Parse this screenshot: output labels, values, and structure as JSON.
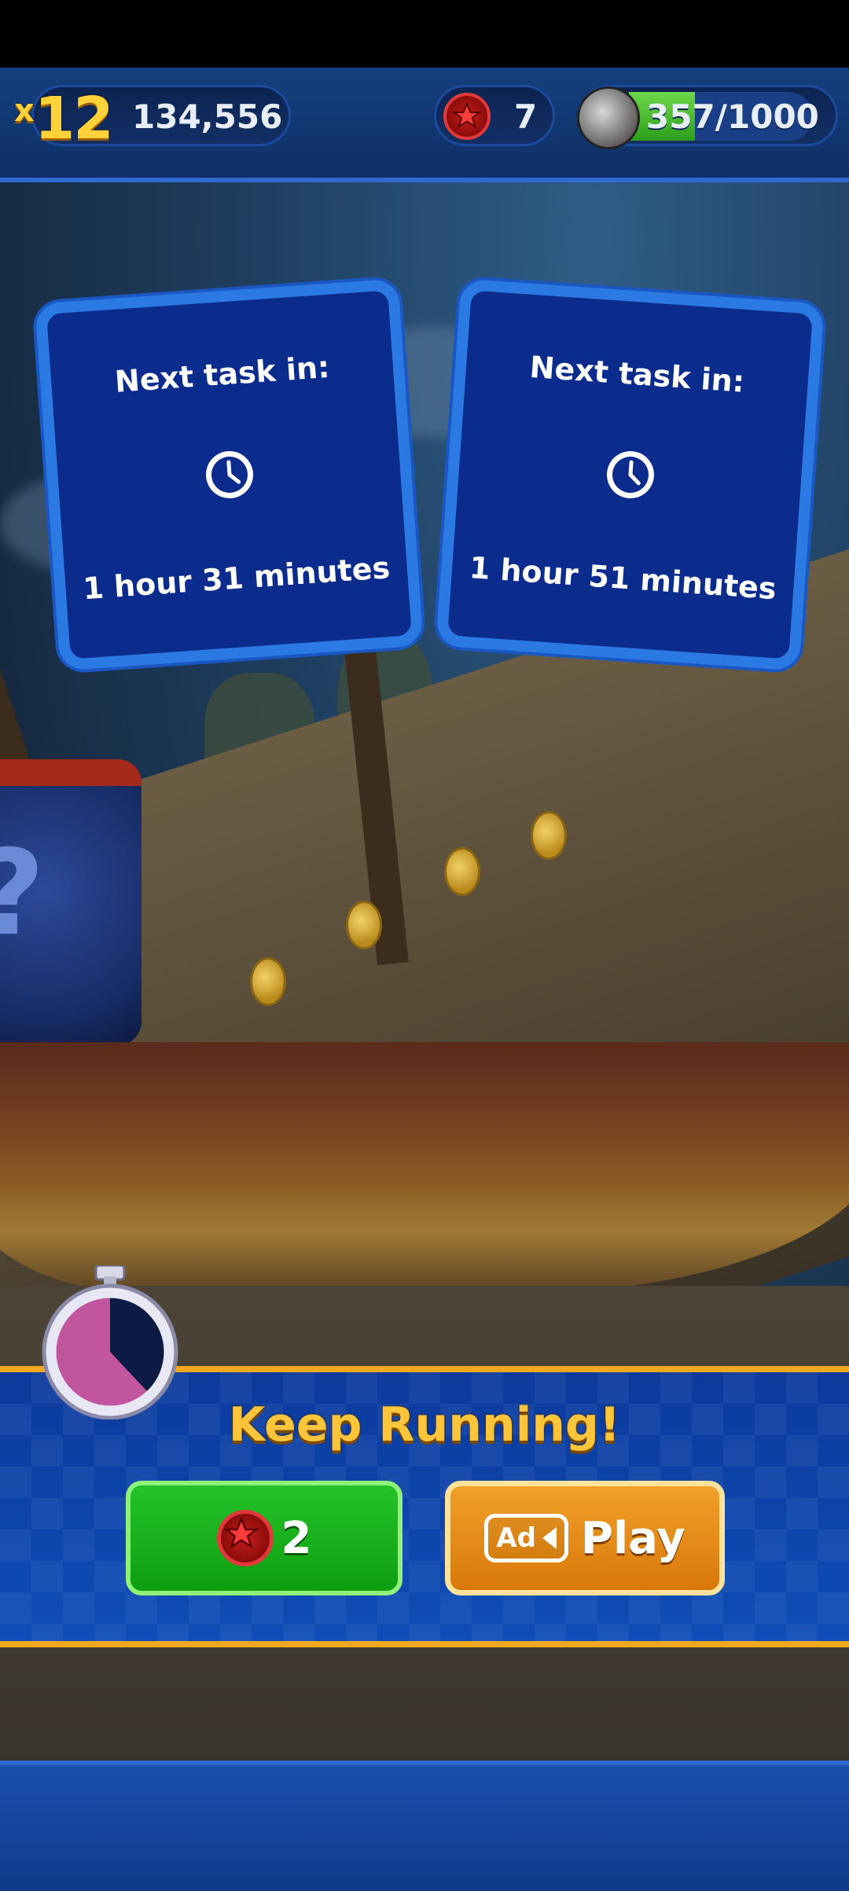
{
  "hud": {
    "multiplier_prefix": "x",
    "multiplier_value": "12",
    "score": "134,556",
    "red_rings": "7",
    "energy": "357/1000",
    "energy_fraction": 0.357
  },
  "task_cards": [
    {
      "label": "Next task in:",
      "time": "1 hour 31 minutes",
      "icon": "clock-icon"
    },
    {
      "label": "Next task in:",
      "time": "1 hour 51 minutes",
      "icon": "clock-icon"
    }
  ],
  "continue": {
    "title": "Keep Running!",
    "ring_cost": "2",
    "ad_badge": "Ad",
    "ad_label": "Play",
    "timer_remaining_fraction": 0.62
  },
  "scene": {
    "mystery_symbol": "?"
  },
  "colors": {
    "hud_bg": "#14407e",
    "card_bg": "#0b2c8c",
    "card_border": "#2b79e2",
    "title_gold": "#ffc53a",
    "green_button": "#0d9e10",
    "orange_button": "#d9780a",
    "panel_border": "#f0a81e"
  }
}
